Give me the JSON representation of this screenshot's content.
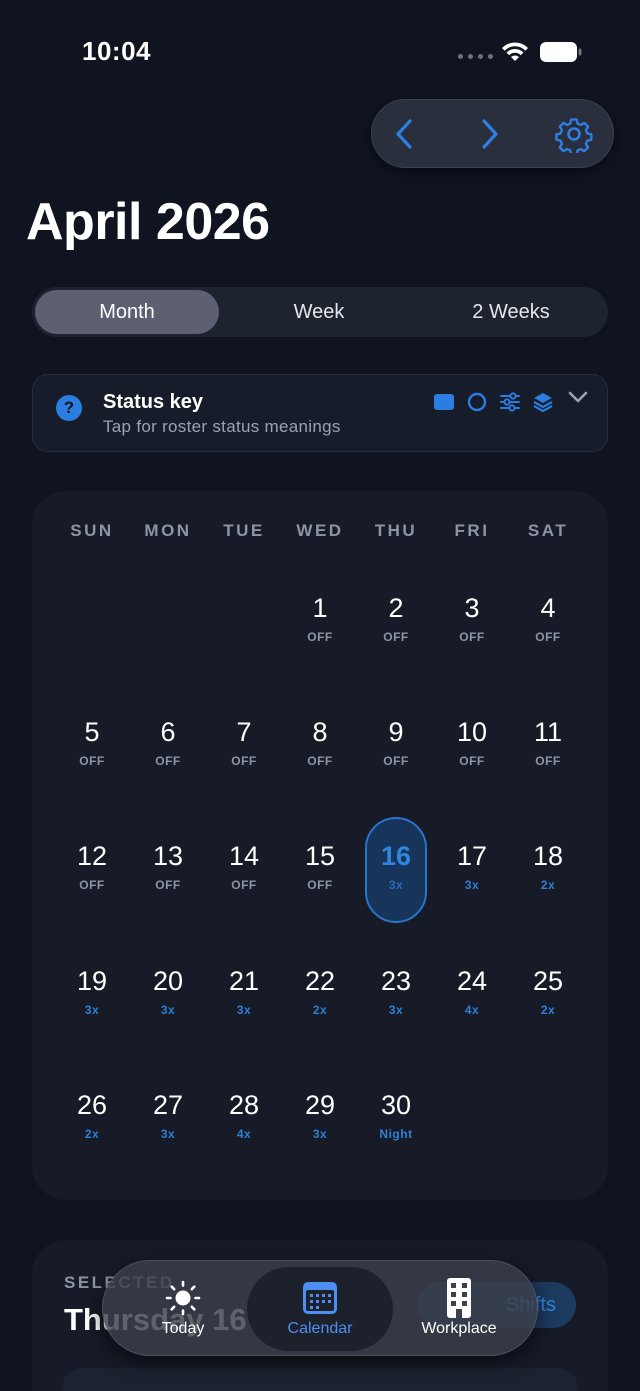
{
  "status_bar": {
    "time": "10:04",
    "icons": [
      "signal-dots-icon",
      "wifi-icon",
      "battery-icon"
    ]
  },
  "nav": {
    "prev_icon": "chevron-left-icon",
    "next_icon": "chevron-right-icon",
    "settings_icon": "gear-icon",
    "accent": "#2f7fe6"
  },
  "header": {
    "month_title": "April 2026"
  },
  "view_switch": {
    "options": [
      {
        "label": "Month",
        "selected": true
      },
      {
        "label": "Week",
        "selected": false
      },
      {
        "label": "2 Weeks",
        "selected": false
      }
    ]
  },
  "status_key": {
    "icon": "question-circle-icon",
    "title": "Status key",
    "subtitle": "Tap for roster status meanings",
    "legend_icons": [
      "filled-square-icon",
      "ring-icon",
      "sliders-icon",
      "layers-icon"
    ],
    "expand_icon": "chevron-down-icon"
  },
  "calendar": {
    "weekdays": [
      "SUN",
      "MON",
      "TUE",
      "WED",
      "THU",
      "FRI",
      "SAT"
    ],
    "first_weekday_index": 3,
    "selected_day": 16,
    "days": [
      {
        "num": "1",
        "status": "OFF"
      },
      {
        "num": "2",
        "status": "OFF"
      },
      {
        "num": "3",
        "status": "OFF"
      },
      {
        "num": "4",
        "status": "OFF"
      },
      {
        "num": "5",
        "status": "OFF"
      },
      {
        "num": "6",
        "status": "OFF"
      },
      {
        "num": "7",
        "status": "OFF"
      },
      {
        "num": "8",
        "status": "OFF"
      },
      {
        "num": "9",
        "status": "OFF"
      },
      {
        "num": "10",
        "status": "OFF"
      },
      {
        "num": "11",
        "status": "OFF"
      },
      {
        "num": "12",
        "status": "OFF"
      },
      {
        "num": "13",
        "status": "OFF"
      },
      {
        "num": "14",
        "status": "OFF"
      },
      {
        "num": "15",
        "status": "OFF"
      },
      {
        "num": "16",
        "status": "3x"
      },
      {
        "num": "17",
        "status": "3x"
      },
      {
        "num": "18",
        "status": "2x"
      },
      {
        "num": "19",
        "status": "3x"
      },
      {
        "num": "20",
        "status": "3x"
      },
      {
        "num": "21",
        "status": "3x"
      },
      {
        "num": "22",
        "status": "2x"
      },
      {
        "num": "23",
        "status": "3x"
      },
      {
        "num": "24",
        "status": "4x"
      },
      {
        "num": "25",
        "status": "2x"
      },
      {
        "num": "26",
        "status": "2x"
      },
      {
        "num": "27",
        "status": "3x"
      },
      {
        "num": "28",
        "status": "4x"
      },
      {
        "num": "29",
        "status": "3x"
      },
      {
        "num": "30",
        "status": "Night"
      }
    ]
  },
  "selected_panel": {
    "label": "SELECTED",
    "date": "Thursday 16 April",
    "action": "Shifts"
  },
  "tab_bar": {
    "tabs": [
      {
        "label": "Today",
        "icon": "sun-icon",
        "active": false
      },
      {
        "label": "Calendar",
        "icon": "calendar-icon",
        "active": true
      },
      {
        "label": "Workplace",
        "icon": "building-icon",
        "active": false
      }
    ]
  }
}
